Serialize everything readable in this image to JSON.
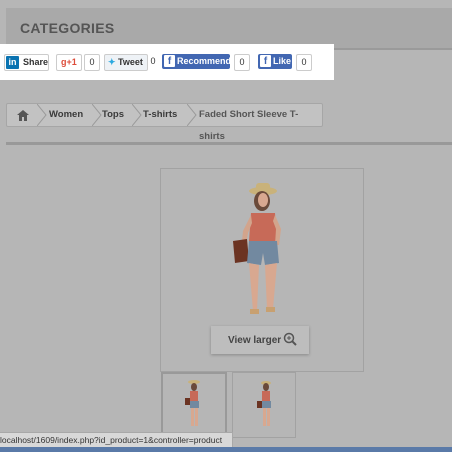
{
  "categories": {
    "title": "CATEGORIES"
  },
  "social": {
    "linkedin": {
      "label": "Share",
      "icon": "in"
    },
    "googleplus": {
      "label": "g+1",
      "count": "0"
    },
    "twitter": {
      "label": "Tweet",
      "count": "0"
    },
    "facebook_recommend": {
      "label": "Recommend",
      "count": "0"
    },
    "facebook_like": {
      "label": "Like",
      "count": "0"
    }
  },
  "breadcrumb": {
    "home_icon": "home-icon",
    "items": [
      "Women",
      "Tops",
      "T-shirts",
      "Faded Short Sleeve T-shirts"
    ]
  },
  "product": {
    "view_larger_label": "View larger"
  },
  "status_bar": {
    "url": "localhost/1609/index.php?id_product=1&controller=product"
  },
  "colors": {
    "overlay": "#b6b6b6",
    "linkedin_blue": "#0a73b1",
    "google_red": "#dd4b39",
    "twitter_blue": "#2aa9e0",
    "facebook_blue": "#4267b2"
  }
}
